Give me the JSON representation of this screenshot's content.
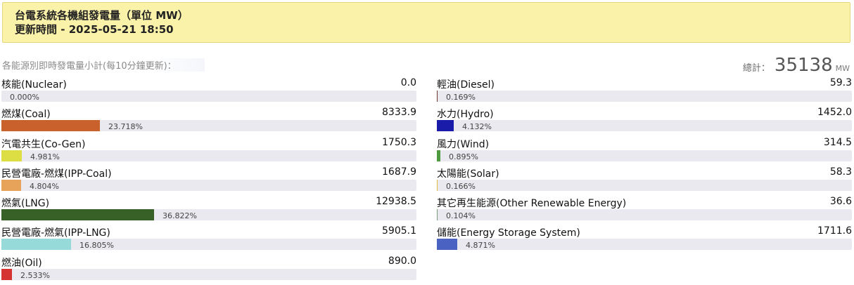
{
  "header": {
    "title": "台電系統各機組發電量（單位 MW）",
    "update_label": "更新時間",
    "update_time": "2025-05-21 18:50"
  },
  "summary": {
    "subtitle": "各能源別即時發電量小計(每10分鐘更新)：",
    "total_label": "總計：",
    "total_value": "35138",
    "total_unit": "MW"
  },
  "left_items": [
    {
      "id": "nuclear",
      "label": "核能(Nuclear)",
      "value": "0.0",
      "percent_text": "0.000%",
      "fraction": 0.0,
      "color": "#888888"
    },
    {
      "id": "coal",
      "label": "燃煤(Coal)",
      "value": "8333.9",
      "percent_text": "23.718%",
      "fraction": 0.23718,
      "color": "#c8612c"
    },
    {
      "id": "cogen",
      "label": "汽電共生(Co-Gen)",
      "value": "1750.3",
      "percent_text": "4.981%",
      "fraction": 0.04981,
      "color": "#dddd44"
    },
    {
      "id": "ipp-coal",
      "label": "民營電廠-燃煤(IPP-Coal)",
      "value": "1687.9",
      "percent_text": "4.804%",
      "fraction": 0.04804,
      "color": "#e8a35a"
    },
    {
      "id": "lng",
      "label": "燃氣(LNG)",
      "value": "12938.5",
      "percent_text": "36.822%",
      "fraction": 0.36822,
      "color": "#386128"
    },
    {
      "id": "ipp-lng",
      "label": "民營電廠-燃氣(IPP-LNG)",
      "value": "5905.1",
      "percent_text": "16.805%",
      "fraction": 0.16805,
      "color": "#97dada"
    },
    {
      "id": "oil",
      "label": "燃油(Oil)",
      "value": "890.0",
      "percent_text": "2.533%",
      "fraction": 0.02533,
      "color": "#d53232"
    }
  ],
  "right_items": [
    {
      "id": "diesel",
      "label": "輕油(Diesel)",
      "value": "59.3",
      "percent_text": "0.169%",
      "fraction": 0.00169,
      "color": "#6b3b2b"
    },
    {
      "id": "hydro",
      "label": "水力(Hydro)",
      "value": "1452.0",
      "percent_text": "4.132%",
      "fraction": 0.04132,
      "color": "#1b1baa"
    },
    {
      "id": "wind",
      "label": "風力(Wind)",
      "value": "314.5",
      "percent_text": "0.895%",
      "fraction": 0.00895,
      "color": "#4e9a3e"
    },
    {
      "id": "solar",
      "label": "太陽能(Solar)",
      "value": "58.3",
      "percent_text": "0.166%",
      "fraction": 0.00166,
      "color": "#e0c040"
    },
    {
      "id": "other-renewable",
      "label": "其它再生能源(Other Renewable Energy)",
      "value": "36.6",
      "percent_text": "0.104%",
      "fraction": 0.00104,
      "color": "#7aa07a"
    },
    {
      "id": "storage",
      "label": "儲能(Energy Storage System)",
      "value": "1711.6",
      "percent_text": "4.871%",
      "fraction": 0.04871,
      "color": "#4a63c2"
    }
  ]
}
